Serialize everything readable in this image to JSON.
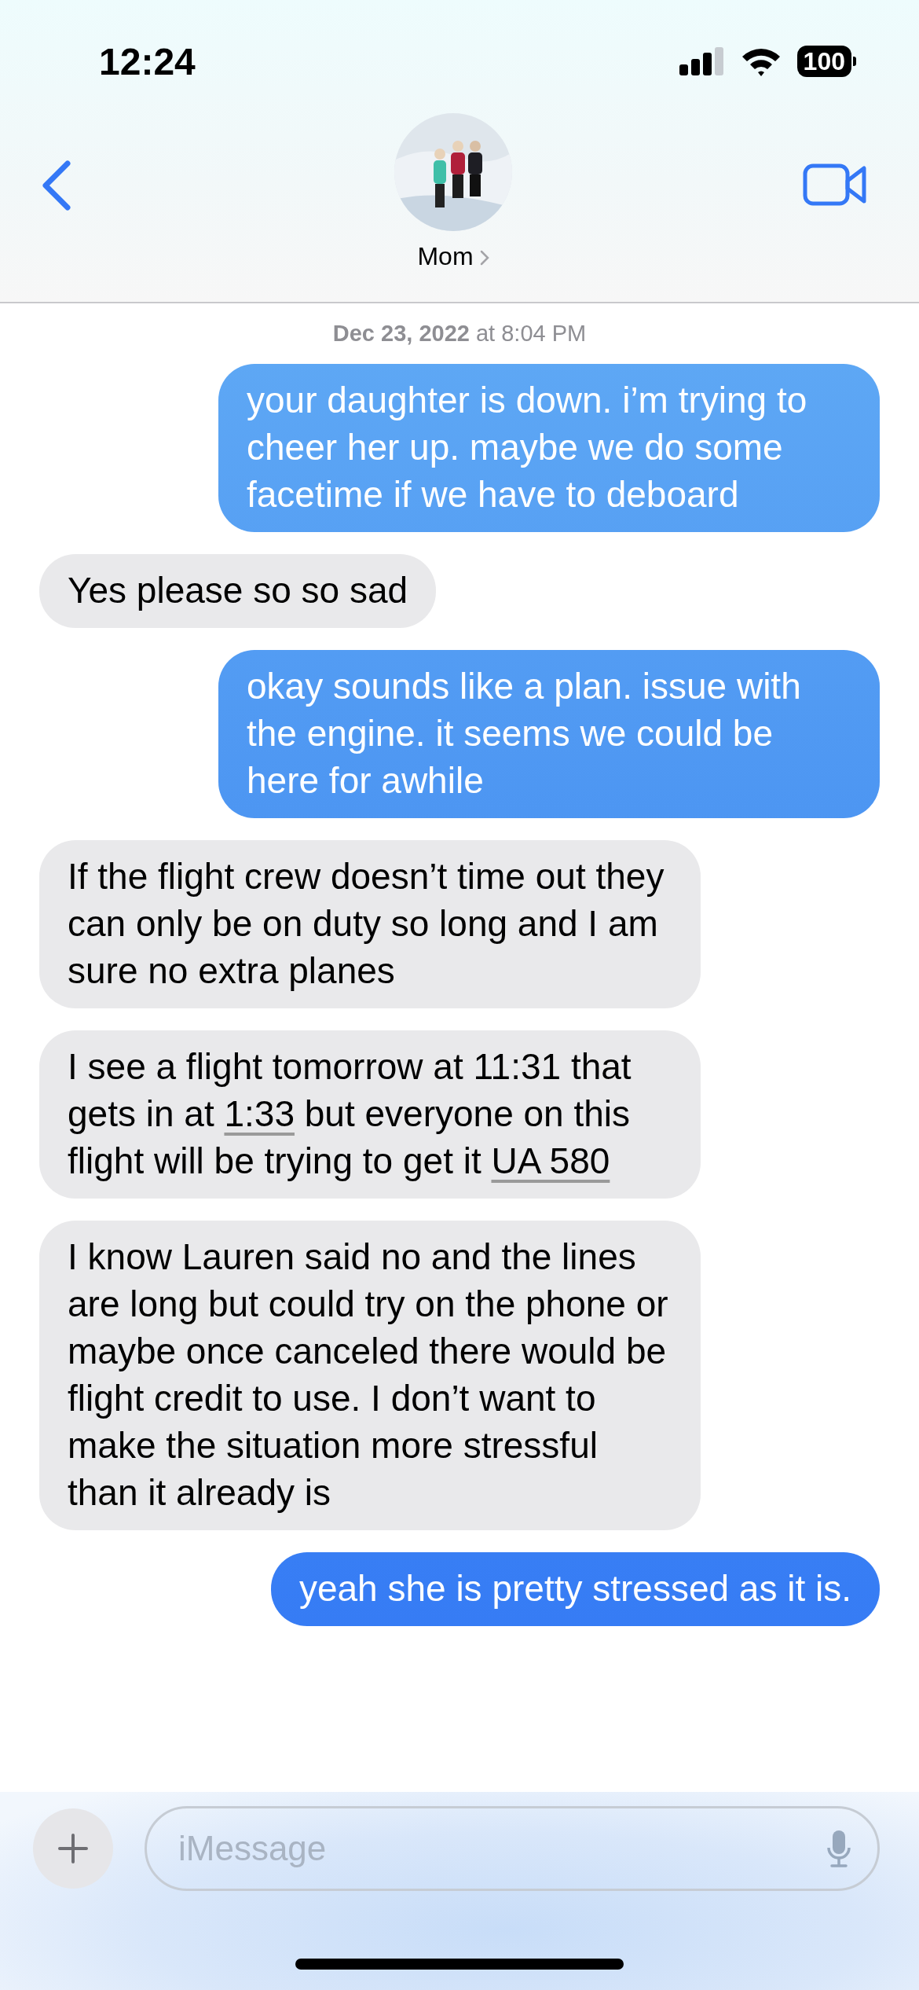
{
  "status_bar": {
    "time": "12:24",
    "battery": "100"
  },
  "header": {
    "contact": "Mom"
  },
  "conversation": {
    "timestamp": "**Dec 23, 2022** at 8:04 PM",
    "messages": [
      {
        "kind": "sent",
        "segments": [
          {
            "kind": "text",
            "text": "your daughter is down. i’m trying to cheer her up. maybe we do some facetime if we have to deboard"
          }
        ]
      },
      {
        "kind": "received",
        "segments": [
          {
            "kind": "text",
            "text": "Yes please so so sad"
          }
        ]
      },
      {
        "kind": "sent",
        "segments": [
          {
            "kind": "text",
            "text": "okay sounds like a plan. issue with the engine. it seems we could be here for awhile"
          }
        ]
      },
      {
        "kind": "received",
        "segments": [
          {
            "kind": "text",
            "text": "If the flight crew doesn’t time out they can only be on duty so long and I am sure no extra planes"
          }
        ]
      },
      {
        "kind": "received",
        "segments": [
          {
            "kind": "text",
            "text": "I see a flight tomorrow at 11:31 that gets in at "
          },
          {
            "kind": "link",
            "text": "1:33"
          },
          {
            "kind": "text",
            "text": " but everyone on this flight will be trying to get it "
          },
          {
            "kind": "link",
            "text": "UA 580"
          }
        ]
      },
      {
        "kind": "received",
        "segments": [
          {
            "kind": "text",
            "text": "I know Lauren said no and the lines are long but could try on the phone or maybe once canceled there would be flight credit to use. I don’t want to make the situation more stressful than it already is"
          }
        ]
      },
      {
        "kind": "sent",
        "segments": [
          {
            "kind": "text",
            "text": "yeah she is pretty stressed as it is."
          }
        ]
      }
    ]
  },
  "composer": {
    "placeholder": "iMessage"
  }
}
